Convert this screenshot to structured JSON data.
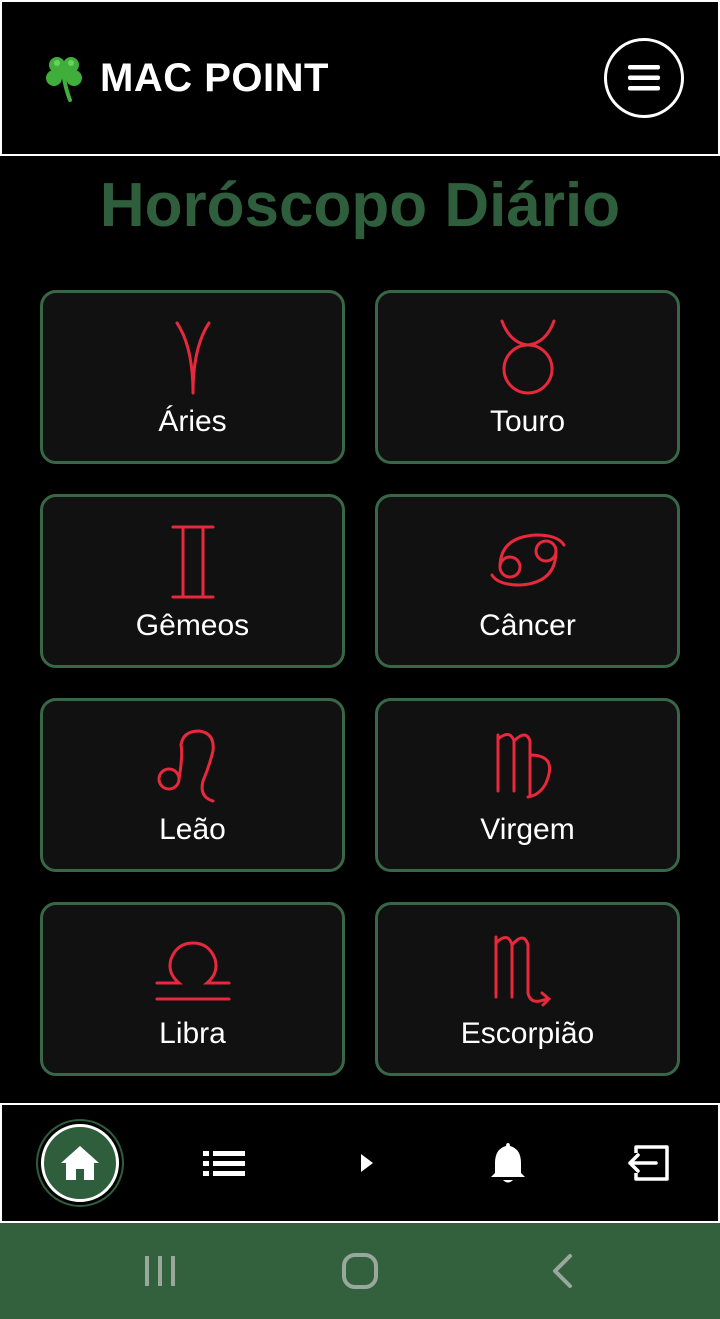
{
  "header": {
    "brand_name": "MAC POINT",
    "logo_icon": "four-leaf-clover-icon",
    "menu_icon": "hamburger-menu-icon"
  },
  "page": {
    "title": "Horóscopo Diário"
  },
  "signs": [
    {
      "label": "Áries",
      "icon": "aries-icon"
    },
    {
      "label": "Touro",
      "icon": "taurus-icon"
    },
    {
      "label": "Gêmeos",
      "icon": "gemini-icon"
    },
    {
      "label": "Câncer",
      "icon": "cancer-icon"
    },
    {
      "label": "Leão",
      "icon": "leo-icon"
    },
    {
      "label": "Virgem",
      "icon": "virgo-icon"
    },
    {
      "label": "Libra",
      "icon": "libra-icon"
    },
    {
      "label": "Escorpião",
      "icon": "scorpio-icon"
    }
  ],
  "bottom_nav": {
    "items": [
      {
        "icon": "home-icon",
        "active": true
      },
      {
        "icon": "list-icon",
        "active": false
      },
      {
        "icon": "play-icon",
        "active": false
      },
      {
        "icon": "bell-icon",
        "active": false
      },
      {
        "icon": "logout-icon",
        "active": false
      }
    ]
  },
  "system_nav": {
    "items": [
      {
        "icon": "recent-apps-icon"
      },
      {
        "icon": "home-circle-icon"
      },
      {
        "icon": "back-icon"
      }
    ]
  },
  "colors": {
    "accent_green": "#2f5e3d",
    "card_border": "#3a6648",
    "sign_red": "#e8283c",
    "system_bar": "#33613e"
  }
}
